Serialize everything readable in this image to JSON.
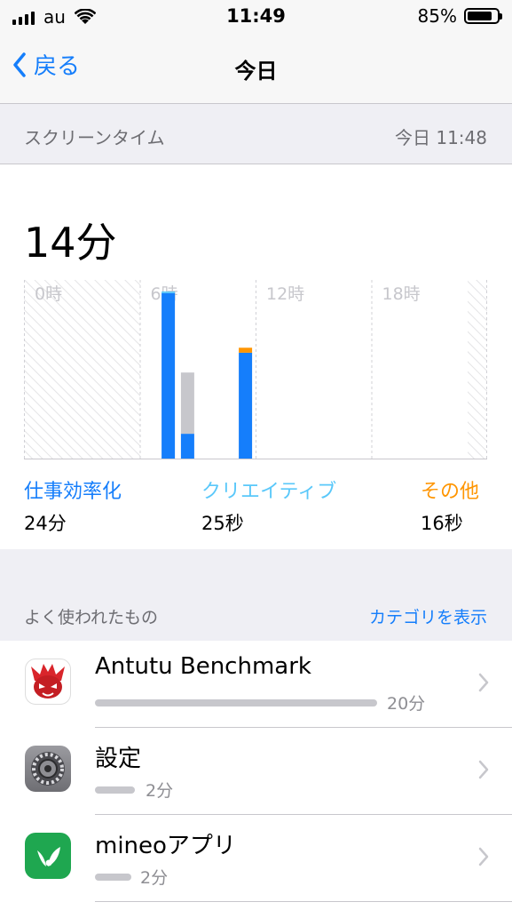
{
  "status": {
    "carrier": "au",
    "time": "11:49",
    "battery": "85%",
    "battery_level": 0.85
  },
  "nav": {
    "back_label": "戻る",
    "title": "今日"
  },
  "screen_time_header": {
    "label": "スクリーンタイム",
    "updated": "今日 11:48"
  },
  "summary": {
    "total": "14分"
  },
  "chart_data": {
    "type": "bar",
    "x_ticks": [
      "0時",
      "6時",
      "12時",
      "18時"
    ],
    "stacked": true,
    "series_colors": {
      "productivity": "#157efb",
      "creativity": "#5ac8fa",
      "other": "#ff9500",
      "uncategorized": "#c7c7cc"
    },
    "bars": [
      {
        "hour": 7,
        "productivity": 10,
        "creativity": 0.1,
        "other": 0,
        "uncategorized": 0
      },
      {
        "hour": 8,
        "productivity": 1.5,
        "creativity": 0,
        "other": 0,
        "uncategorized": 3.7
      },
      {
        "hour": 11,
        "productivity": 6.4,
        "creativity": 0,
        "other": 0.3,
        "uncategorized": 0
      }
    ],
    "ylim": [
      0,
      10.8
    ]
  },
  "categories": [
    {
      "name": "仕事効率化",
      "value": "24分",
      "color": "#157efb"
    },
    {
      "name": "クリエイティブ",
      "value": "25秒",
      "color": "#5ac8fa"
    },
    {
      "name": "その他",
      "value": "16秒",
      "color": "#ff9500"
    }
  ],
  "most_used": {
    "label": "よく使われたもの",
    "action": "カテゴリを表示"
  },
  "apps": [
    {
      "name": "Antutu Benchmark",
      "time": "20分",
      "fraction": 1.0
    },
    {
      "name": "設定",
      "time": "2分",
      "fraction": 0.14
    },
    {
      "name": "mineoアプリ",
      "time": "2分",
      "fraction": 0.13
    }
  ],
  "colors": {
    "accent": "#157efb",
    "background": "#efeff4"
  }
}
